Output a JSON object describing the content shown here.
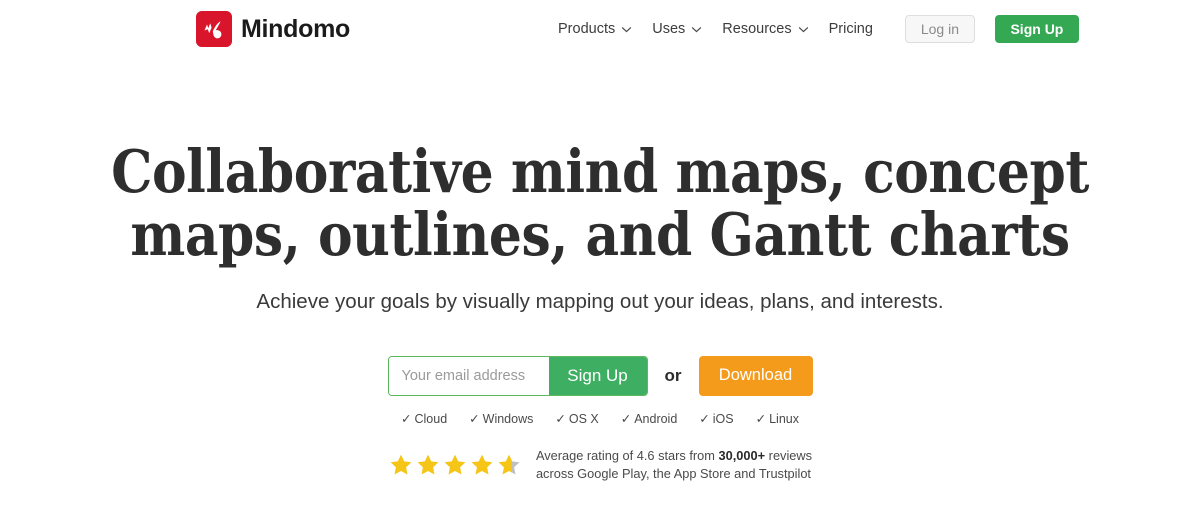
{
  "brand": {
    "name": "Mindomo",
    "logo_icon": "mindomo-logo-icon",
    "logo_color": "#D8152A"
  },
  "nav": {
    "items": [
      {
        "label": "Products",
        "has_dropdown": true
      },
      {
        "label": "Uses",
        "has_dropdown": true
      },
      {
        "label": "Resources",
        "has_dropdown": true
      },
      {
        "label": "Pricing",
        "has_dropdown": false
      }
    ],
    "login_label": "Log in",
    "signup_label": "Sign Up",
    "signup_color": "#34A853"
  },
  "hero": {
    "headline": "Collaborative mind maps, concept maps, outlines, and Gantt charts",
    "subheadline": "Achieve your goals by visually mapping out your ideas, plans, and interests."
  },
  "signup_form": {
    "email_placeholder": "Your email address",
    "email_value": "",
    "signup_label": "Sign Up",
    "or_label": "or",
    "download_label": "Download",
    "signup_color": "#3EAE62",
    "download_color": "#F59B1C"
  },
  "platforms": {
    "tick": "✓",
    "items": [
      "Cloud",
      "Windows",
      "OS X",
      "Android",
      "iOS",
      "Linux"
    ]
  },
  "rating": {
    "stars_total": 5,
    "stars_filled": 4.6,
    "star_color": "#F5C518",
    "star_empty_color": "#BFBFBF",
    "line1_prefix": "Average rating of 4.6 stars from ",
    "line1_bold": "30,000+",
    "line1_suffix": " reviews",
    "line2": "across Google Play, the App Store and Trustpilot"
  }
}
